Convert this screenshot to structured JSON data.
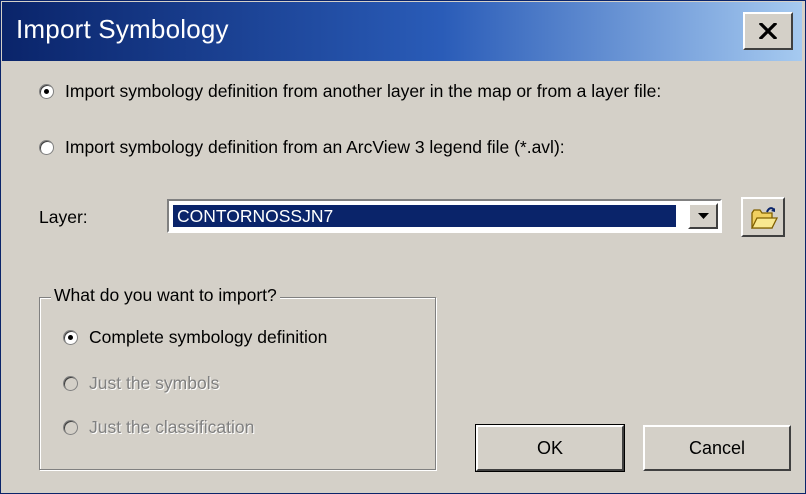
{
  "window": {
    "title": "Import Symbology",
    "close_label": "×"
  },
  "source_options": [
    {
      "label": "Import symbology definition from another layer in the map or from a layer file:",
      "checked": true,
      "enabled": true
    },
    {
      "label": "Import symbology definition from an ArcView 3 legend file (*.avl):",
      "checked": false,
      "enabled": true
    }
  ],
  "layer": {
    "label": "Layer:",
    "value": "CONTORNOSSJN7"
  },
  "import_group": {
    "legend": "What do you want to import?",
    "options": [
      {
        "label": "Complete symbology definition",
        "checked": true,
        "enabled": true
      },
      {
        "label": "Just the symbols",
        "checked": false,
        "enabled": false
      },
      {
        "label": "Just the classification",
        "checked": false,
        "enabled": false
      }
    ]
  },
  "buttons": {
    "ok": "OK",
    "cancel": "Cancel"
  },
  "icons": {
    "close": "close-icon",
    "dropdown": "chevron-down-icon",
    "browse": "open-folder-icon"
  },
  "colors": {
    "title_start": "#0a246a",
    "title_end": "#a6caf0",
    "dialog_bg": "#d4d0c8",
    "selection": "#0a246a"
  }
}
